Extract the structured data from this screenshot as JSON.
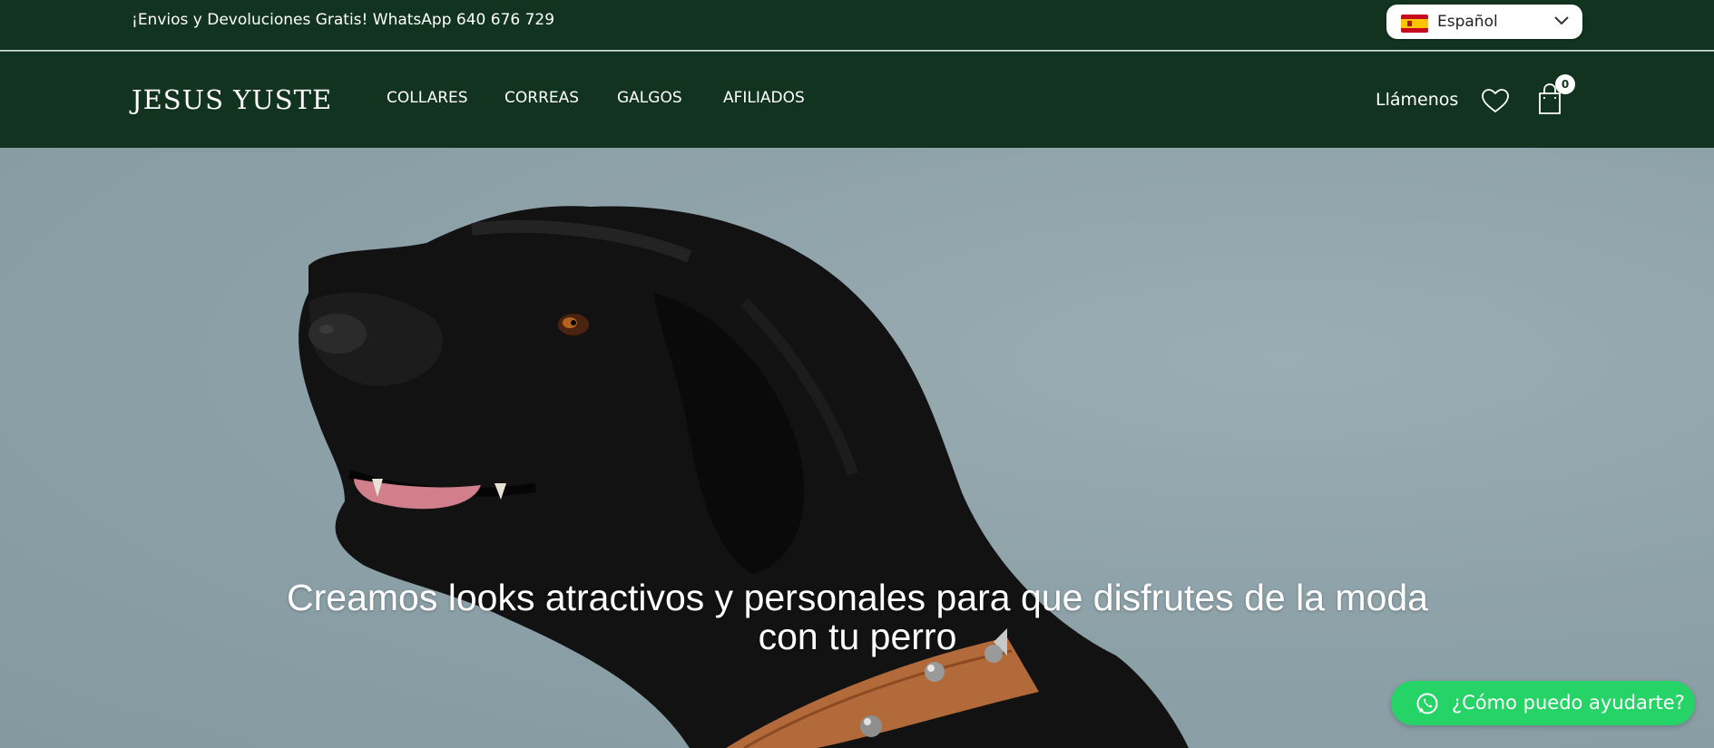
{
  "topbar": {
    "promo_text": "¡Envios y Devoluciones Gratis! WhatsApp 640 676 729",
    "language": {
      "selected": "Español",
      "flag_icon": "spain-flag-icon"
    }
  },
  "header": {
    "logo_text": "JESUS YUSTE",
    "nav": [
      {
        "label": "COLLARES"
      },
      {
        "label": "CORREAS"
      },
      {
        "label": "GALGOS"
      },
      {
        "label": "AFILIADOS"
      }
    ],
    "call_label": "Llámenos",
    "cart_count": "0",
    "icons": [
      "heart-icon",
      "shopping-bag-icon"
    ]
  },
  "hero": {
    "title": "Creamos looks atractivos y personales para que disfrutes de la moda con tu perro"
  },
  "whatsapp": {
    "label": "¿Cómo puedo ayudarte?",
    "icon": "whatsapp-icon"
  },
  "colors": {
    "header_bg": "#12331f",
    "whatsapp_green": "#25d366",
    "hero_bg": "#8fa3aa"
  }
}
